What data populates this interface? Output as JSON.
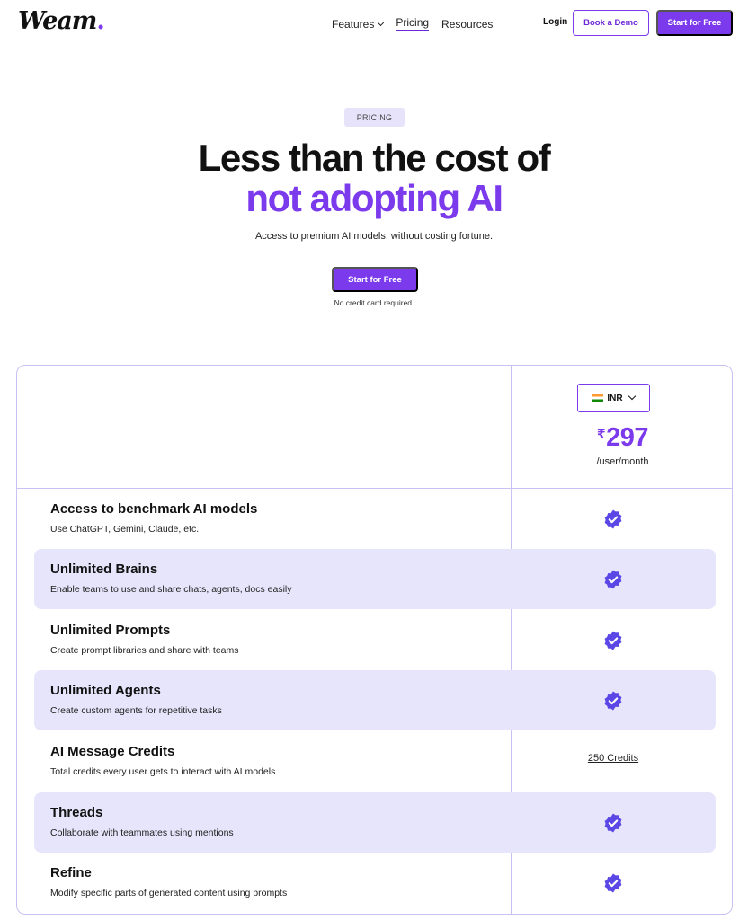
{
  "brand": {
    "logo_text": "Weam",
    "logo_dot": ".",
    "accent": "#7c3aed"
  },
  "nav": {
    "items": [
      {
        "label": "Features",
        "has_dropdown": true
      },
      {
        "label": "Pricing",
        "active": true
      },
      {
        "label": "Resources"
      }
    ],
    "login": "Login",
    "book_demo": "Book a Demo",
    "start_free": "Start for Free"
  },
  "hero": {
    "badge": "PRICING",
    "headline_line1": "Less than the cost of",
    "headline_line2": "not adopting AI",
    "subheadline": "Access to premium AI models, without costing fortune.",
    "cta": "Start for Free",
    "note": "No credit card required."
  },
  "plan": {
    "currency": "INR",
    "currency_icon": "india-flag-icon",
    "price_symbol": "₹",
    "price": "297",
    "period": "/user/month"
  },
  "features": [
    {
      "title": "Access to benchmark AI models",
      "desc": "Use ChatGPT, Gemini, Claude, etc.",
      "value": "check"
    },
    {
      "title": "Unlimited Brains",
      "desc": "Enable teams to use and share chats, agents, docs easily",
      "value": "check"
    },
    {
      "title": "Unlimited Prompts",
      "desc": "Create prompt libraries and share with teams",
      "value": "check"
    },
    {
      "title": "Unlimited Agents",
      "desc": "Create custom agents for repetitive tasks",
      "value": "check"
    },
    {
      "title": "AI Message Credits",
      "desc": "Total credits every user gets to interact with AI models",
      "value": "250 Credits"
    },
    {
      "title": "Threads",
      "desc": "Collaborate with teammates using mentions",
      "value": "check"
    },
    {
      "title": "Refine",
      "desc": "Modify specific parts of generated content using prompts",
      "value": "check"
    }
  ]
}
